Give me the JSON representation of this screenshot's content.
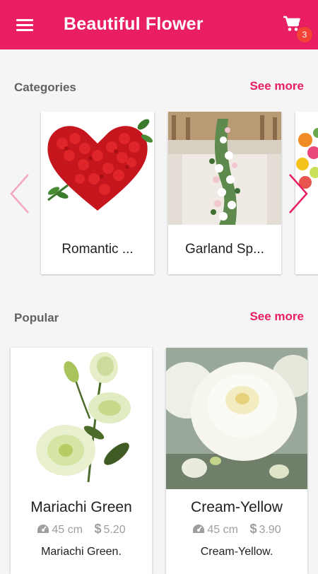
{
  "appbar": {
    "title": "Beautiful Flower",
    "cart_count": "3",
    "color": "#e91e63"
  },
  "categories": {
    "title": "Categories",
    "see_more": "See more",
    "items": [
      {
        "label": "Romantic ..."
      },
      {
        "label": "Garland Sp..."
      }
    ]
  },
  "popular": {
    "title": "Popular",
    "see_more": "See more",
    "items": [
      {
        "name": "Mariachi Green",
        "size": "45 cm",
        "price": "5.20",
        "description": "Mariachi Green."
      },
      {
        "name": "Cream-Yellow",
        "size": "45 cm",
        "price": "3.90",
        "description": "Cream-Yellow."
      }
    ]
  },
  "icons": {
    "menu": "menu-icon",
    "cart": "cart-icon",
    "prev": "chevron-left-icon",
    "next": "chevron-right-icon",
    "size": "speedometer-icon",
    "price": "dollar-icon"
  }
}
